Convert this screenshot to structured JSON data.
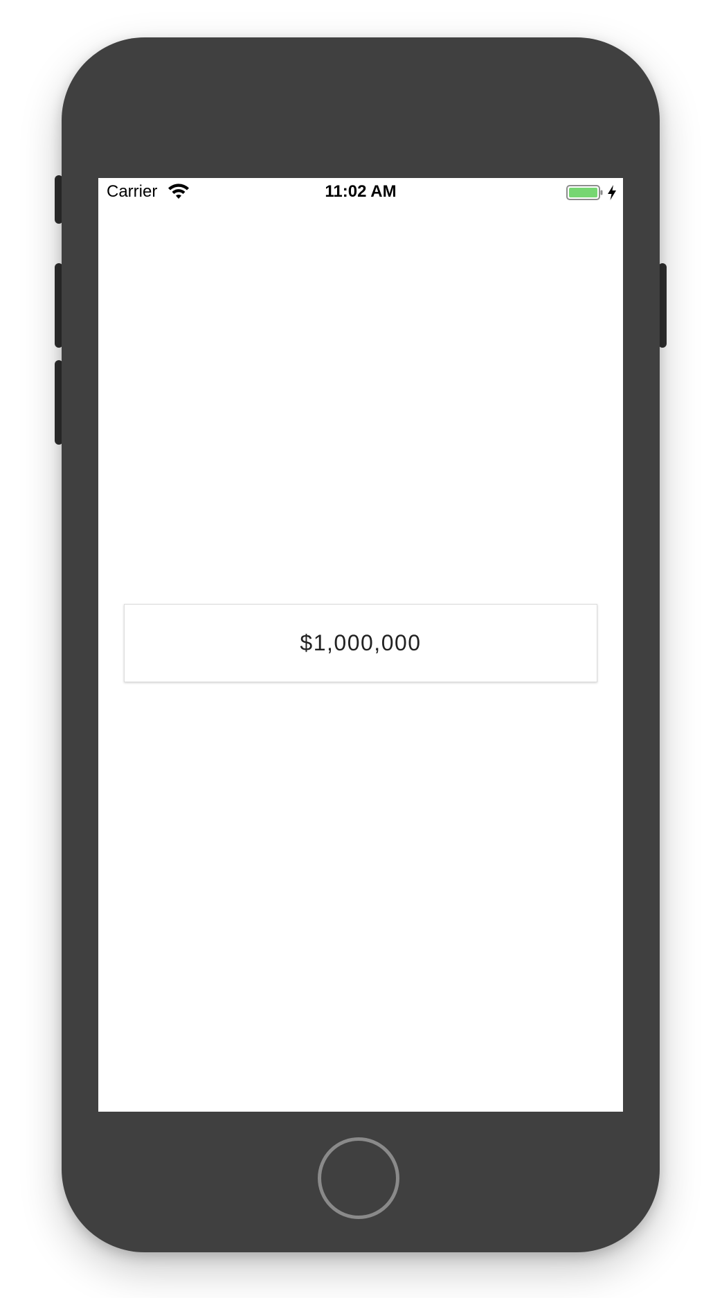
{
  "status_bar": {
    "carrier": "Carrier",
    "time": "11:02 AM",
    "wifi_icon": "wifi-icon",
    "battery_icon": "battery-charging-icon",
    "battery_color": "#76d672"
  },
  "main": {
    "amount": "$1,000,000"
  },
  "device": {
    "frame_color": "#404040",
    "home_button": "home-button"
  }
}
